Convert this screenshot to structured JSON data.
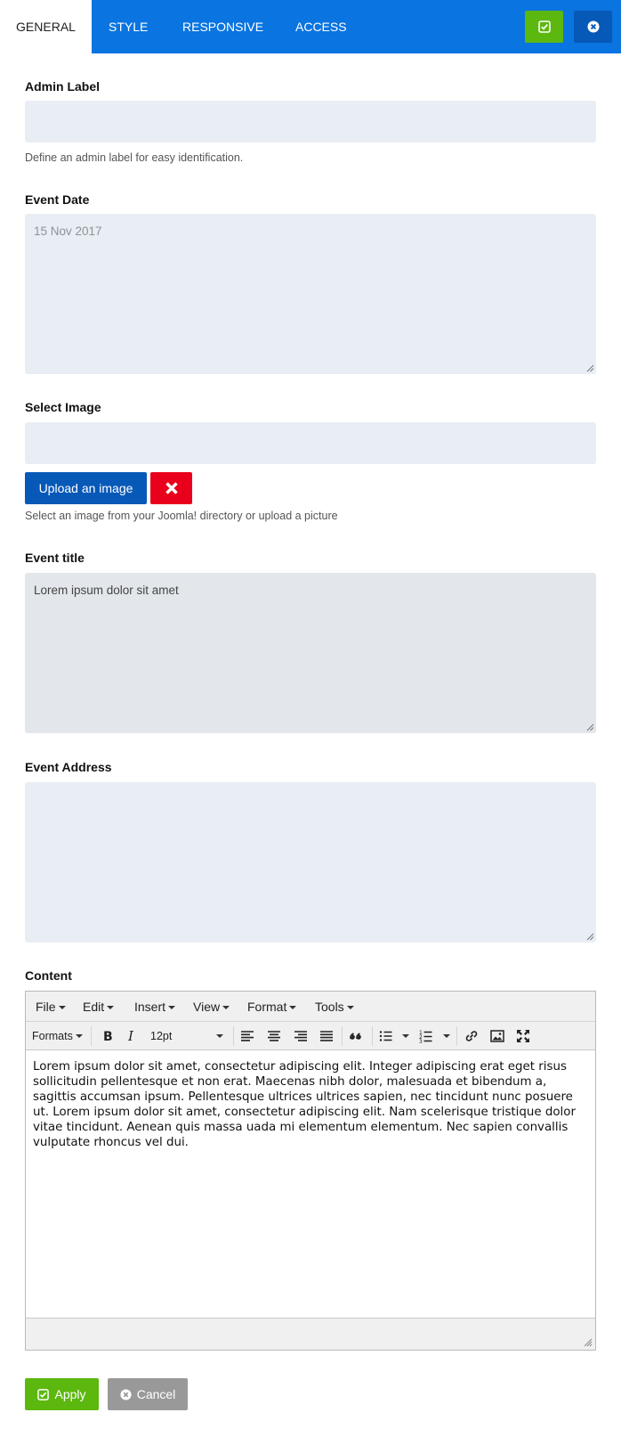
{
  "tabs": [
    {
      "label": "GENERAL",
      "active": true
    },
    {
      "label": "STYLE",
      "active": false
    },
    {
      "label": "RESPONSIVE",
      "active": false
    },
    {
      "label": "ACCESS",
      "active": false
    }
  ],
  "icons": {
    "save": "check-square-icon",
    "close": "times-circle-icon",
    "remove": "x-icon"
  },
  "colors": {
    "header": "#0a74e0",
    "save": "#5cb70f",
    "close": "#0759b8",
    "remove": "#e8001c",
    "cancel": "#999999"
  },
  "admin_label": {
    "label": "Admin Label",
    "value": "",
    "help": "Define an admin label for easy identification."
  },
  "event_date": {
    "label": "Event Date",
    "placeholder": "15 Nov 2017"
  },
  "select_image": {
    "label": "Select Image",
    "value": "",
    "upload_label": "Upload an image",
    "help": "Select an image from your Joomla! directory or upload a picture"
  },
  "event_title": {
    "label": "Event title",
    "value": "Lorem ipsum dolor sit amet"
  },
  "event_address": {
    "label": "Event Address",
    "value": ""
  },
  "content": {
    "label": "Content",
    "menu": [
      "File",
      "Edit",
      "Insert",
      "View",
      "Format",
      "Tools"
    ],
    "formats_label": "Formats",
    "font_size": "12pt",
    "text": "Lorem ipsum dolor sit amet, consectetur adipiscing elit. Integer adipiscing erat eget risus sollicitudin pellentesque et non erat. Maecenas nibh dolor, malesuada et bibendum a, sagittis accumsan ipsum. Pellentesque ultrices ultrices sapien, nec tincidunt nunc posuere ut. Lorem ipsum dolor sit amet, consectetur adipiscing elit. Nam scelerisque tristique dolor vitae tincidunt. Aenean quis massa uada mi elementum elementum. Nec sapien convallis vulputate rhoncus vel dui."
  },
  "footer": {
    "apply_label": "Apply",
    "cancel_label": "Cancel"
  }
}
